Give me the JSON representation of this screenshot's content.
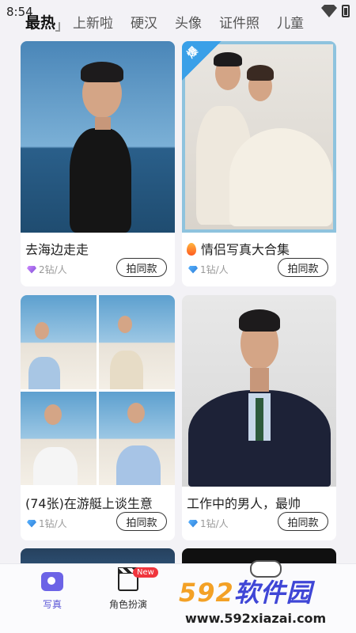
{
  "status": {
    "time": "8:54"
  },
  "tabs": [
    "最热",
    "上新啦",
    "硬汉",
    "头像",
    "证件照",
    "儿童"
  ],
  "cards": [
    {
      "title": "去海边走走",
      "price": "2钻/人",
      "button": "拍同款",
      "hot": false,
      "fire": false
    },
    {
      "title": "情侣写真大合集",
      "price": "1钻/人",
      "button": "拍同款",
      "hot": true,
      "badge": "爆",
      "fire": true
    },
    {
      "title": "(74张)在游艇上谈生意",
      "price": "1钻/人",
      "button": "拍同款"
    },
    {
      "title": "工作中的男人，最帅",
      "price": "1钻/人",
      "button": "拍同款"
    }
  ],
  "bottom_nav": [
    {
      "label": "写真",
      "icon": "camera-icon",
      "active": true
    },
    {
      "label": "角色扮演",
      "icon": "clapperboard-icon",
      "badge": "New"
    }
  ],
  "watermark": {
    "brand_num": "592",
    "brand_text": "软件园",
    "url": "www.592xiazai.com"
  },
  "colors": {
    "accent": "#6c63e6",
    "badge_red": "#f0353d",
    "hot_blue": "#3aa0e8"
  }
}
